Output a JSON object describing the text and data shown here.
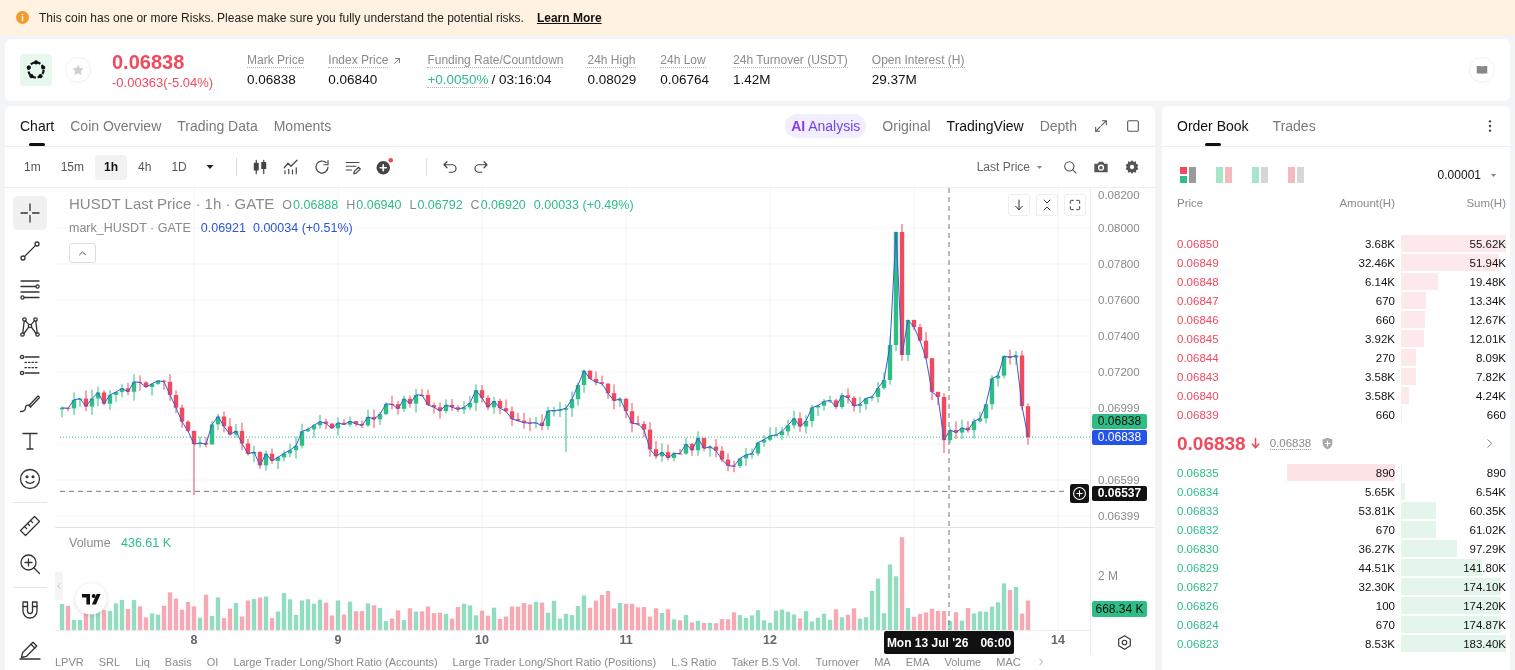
{
  "banner": {
    "message": "This coin has one or more Risks. Please make sure you fully understand the potential risks.",
    "link": "Learn More"
  },
  "ticker": {
    "favorite": false,
    "price": "0.06838",
    "change": "-0.00363(-5.04%)",
    "stats": [
      {
        "label": "Mark Price",
        "value": "0.06838",
        "kind": "plain"
      },
      {
        "label": "Index Price",
        "value": "0.06840",
        "kind": "link"
      },
      {
        "label": "Funding Rate/Countdown",
        "value": "+0.0050%",
        "countdown": "/ 03:16:04",
        "kind": "funding"
      },
      {
        "label": "24h High",
        "value": "0.08029",
        "kind": "plain"
      },
      {
        "label": "24h Low",
        "value": "0.06764",
        "kind": "plain"
      },
      {
        "label": "24h Turnover (USDT)",
        "value": "1.42M",
        "kind": "plain"
      },
      {
        "label": "Open Interest (H)",
        "value": "29.37M",
        "kind": "plain"
      }
    ]
  },
  "chart_panel": {
    "tabs": [
      {
        "label": "Chart",
        "selected": true
      },
      {
        "label": "Coin Overview",
        "selected": false
      },
      {
        "label": "Trading Data",
        "selected": false
      },
      {
        "label": "Moments",
        "selected": false
      }
    ],
    "views": [
      {
        "label": "Analysis",
        "badge": "AI",
        "kind": "ai",
        "selected": false
      },
      {
        "label": "Original",
        "kind": "plain",
        "selected": false
      },
      {
        "label": "TradingView",
        "kind": "plain",
        "selected": true
      },
      {
        "label": "Depth",
        "kind": "plain",
        "selected": false
      }
    ],
    "intervals": [
      {
        "label": "1m",
        "selected": false
      },
      {
        "label": "15m",
        "selected": false
      },
      {
        "label": "1h",
        "selected": true
      },
      {
        "label": "4h",
        "selected": false
      },
      {
        "label": "1D",
        "selected": false
      }
    ],
    "price_source": "Last Price",
    "drawing_tools": [
      [
        {
          "kind": "crosshair",
          "selected": true
        },
        {
          "kind": "trend_line",
          "selected": false
        },
        {
          "kind": "parallel_lines",
          "selected": false
        },
        {
          "kind": "pattern",
          "selected": false
        },
        {
          "kind": "fib",
          "selected": false
        },
        {
          "kind": "brush",
          "selected": false
        },
        {
          "kind": "text",
          "selected": false
        },
        {
          "kind": "emoji",
          "selected": false
        }
      ],
      [
        {
          "kind": "ruler",
          "selected": false
        },
        {
          "kind": "zoom",
          "selected": false
        }
      ],
      [
        {
          "kind": "magnet",
          "selected": false
        },
        {
          "kind": "pencil",
          "selected": false
        }
      ]
    ],
    "legend": {
      "title": "HUSDT Last Price · 1h · GATE",
      "ohlc": [
        {
          "key": "O",
          "value": "0.06888"
        },
        {
          "key": "H",
          "value": "0.06940"
        },
        {
          "key": "L",
          "value": "0.06792"
        },
        {
          "key": "C",
          "value": "0.06920"
        }
      ],
      "change": "0.00033 (+0.49%)"
    },
    "mark_legend": {
      "title": "mark_HUSDT · GATE",
      "value": "0.06921",
      "change": "0.00034 (+0.51%)"
    },
    "price_axis": {
      "labels": [
        "0.08200",
        "0.08000",
        "0.07800",
        "0.07600",
        "0.07400",
        "0.07200",
        "0.06999",
        "0.06599",
        "0.06399"
      ],
      "tags": [
        {
          "value": "0.06838",
          "kind": "last"
        },
        {
          "value": "0.06838",
          "kind": "mark"
        },
        {
          "value": "0.06537",
          "kind": "crosshair"
        }
      ]
    },
    "volume": {
      "label": "Volume",
      "value": "436.61 K",
      "axis_label": "2 M",
      "tag": "668.34 K"
    },
    "time_axis": {
      "labels": [
        "8",
        "9",
        "10",
        "11",
        "12",
        "14"
      ],
      "crosshair_date": "Mon 13 Jul '26",
      "crosshair_time": "06:00"
    },
    "indicators": [
      "LPVR",
      "SRL",
      "Liq",
      "Basis",
      "OI",
      "Large Trader Long/Short Ratio (Accounts)",
      "Large Trader Long/Short Ratio (Positions)",
      "L.S Ratio",
      "Taker B.S Vol.",
      "Turnover",
      "MA",
      "EMA",
      "Volume",
      "MAC"
    ]
  },
  "order_book": {
    "tabs": [
      {
        "label": "Order Book",
        "selected": true
      },
      {
        "label": "Trades",
        "selected": false
      }
    ],
    "layouts": [
      {
        "kind": "both",
        "selected": true
      },
      {
        "kind": "split",
        "selected": false
      },
      {
        "kind": "bids",
        "selected": false
      },
      {
        "kind": "asks",
        "selected": false
      }
    ],
    "precision": "0.00001",
    "columns": [
      "Price",
      "Amount(H)",
      "Sum(H)"
    ],
    "asks": [
      {
        "price": "0.06850",
        "amount": "3.68K",
        "sum": "55.62K"
      },
      {
        "price": "0.06849",
        "amount": "32.46K",
        "sum": "51.94K"
      },
      {
        "price": "0.06848",
        "amount": "6.14K",
        "sum": "19.48K"
      },
      {
        "price": "0.06847",
        "amount": "670",
        "sum": "13.34K"
      },
      {
        "price": "0.06846",
        "amount": "660",
        "sum": "12.67K"
      },
      {
        "price": "0.06845",
        "amount": "3.92K",
        "sum": "12.01K"
      },
      {
        "price": "0.06844",
        "amount": "270",
        "sum": "8.09K"
      },
      {
        "price": "0.06843",
        "amount": "3.58K",
        "sum": "7.82K"
      },
      {
        "price": "0.06840",
        "amount": "3.58K",
        "sum": "4.24K"
      },
      {
        "price": "0.06839",
        "amount": "660",
        "sum": "660"
      }
    ],
    "last": {
      "price": "0.06838",
      "falling": true,
      "mark": "0.06838"
    },
    "bids": [
      {
        "price": "0.06835",
        "amount": "890",
        "sum": "890",
        "flash": true
      },
      {
        "price": "0.06834",
        "amount": "5.65K",
        "sum": "6.54K",
        "flash": false
      },
      {
        "price": "0.06833",
        "amount": "53.81K",
        "sum": "60.35K",
        "flash": false
      },
      {
        "price": "0.06832",
        "amount": "670",
        "sum": "61.02K",
        "flash": false
      },
      {
        "price": "0.06830",
        "amount": "36.27K",
        "sum": "97.29K",
        "flash": false
      },
      {
        "price": "0.06829",
        "amount": "44.51K",
        "sum": "141.80K",
        "flash": false
      },
      {
        "price": "0.06827",
        "amount": "32.30K",
        "sum": "174.10K",
        "flash": false
      },
      {
        "price": "0.06826",
        "amount": "100",
        "sum": "174.20K",
        "flash": false
      },
      {
        "price": "0.06824",
        "amount": "670",
        "sum": "174.87K",
        "flash": false
      },
      {
        "price": "0.06823",
        "amount": "8.53K",
        "sum": "183.40K",
        "flash": false
      }
    ]
  }
}
